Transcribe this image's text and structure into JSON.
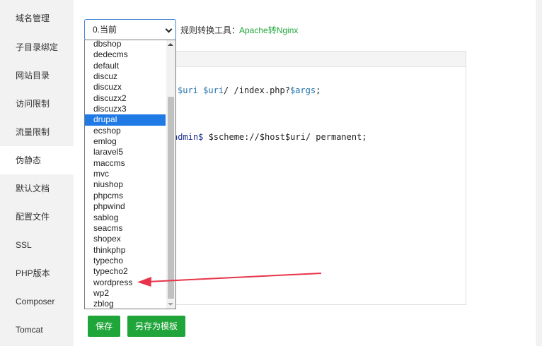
{
  "sidebar": {
    "items": [
      {
        "label": "域名管理"
      },
      {
        "label": "子目录绑定"
      },
      {
        "label": "网站目录"
      },
      {
        "label": "访问限制"
      },
      {
        "label": "流量限制"
      },
      {
        "label": "伪静态",
        "active": true
      },
      {
        "label": "默认文档"
      },
      {
        "label": "配置文件"
      },
      {
        "label": "SSL"
      },
      {
        "label": "PHP版本"
      },
      {
        "label": "Composer"
      },
      {
        "label": "Tomcat"
      }
    ]
  },
  "toolbar": {
    "select_value": "0.当前",
    "rule_label": "规则转换工具：",
    "rule_link": "Apache转Nginx"
  },
  "editor": {
    "line1": {
      "var1": "$uri",
      "var2": "$uri",
      "rest": "/ /index.php?",
      "var3": "$args",
      "end": ";"
    },
    "line2": {
      "kw": "admin$",
      "rest": " $scheme://$host$uri/ permanent;"
    }
  },
  "dropdown": {
    "options": [
      "dbshop",
      "dedecms",
      "default",
      "discuz",
      "discuzx",
      "discuzx2",
      "discuzx3",
      "drupal",
      "ecshop",
      "emlog",
      "laravel5",
      "maccms",
      "mvc",
      "niushop",
      "phpcms",
      "phpwind",
      "sablog",
      "seacms",
      "shopex",
      "thinkphp",
      "typecho",
      "typecho2",
      "wordpress",
      "wp2",
      "zblog"
    ],
    "selected": "drupal"
  },
  "buttons": {
    "save": "保存",
    "save_template": "另存为模板"
  },
  "colors": {
    "accent_green": "#20a53a",
    "selection_blue": "#1f7ae6",
    "annotation_red": "#e8344a"
  }
}
